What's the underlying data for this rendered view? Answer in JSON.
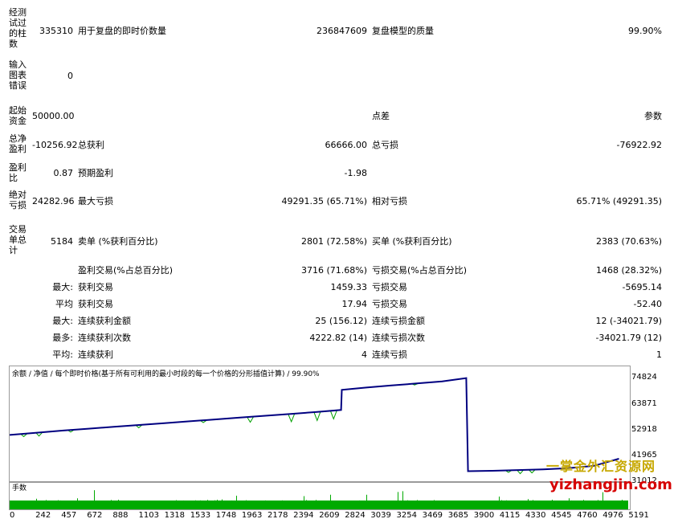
{
  "stats": {
    "bars": {
      "label": "经测试过的柱数",
      "value": "335310"
    },
    "ticks": {
      "label": "用于复盘的即时价数量",
      "value": "236847609"
    },
    "quality": {
      "label": "复盘模型的质量",
      "value": "99.90%"
    },
    "errors": {
      "label": "输入图表错误",
      "value": "0"
    },
    "deposit": {
      "label": "起始资金",
      "value": "50000.00"
    },
    "spread": {
      "label": "点差",
      "value": "参数"
    },
    "net_profit": {
      "label": "总净盈利",
      "value": "-10256.92"
    },
    "gross_profit": {
      "label": "总获利",
      "value": "66666.00"
    },
    "gross_loss": {
      "label": "总亏损",
      "value": "-76922.92"
    },
    "profit_factor": {
      "label": "盈利比",
      "value": "0.87"
    },
    "expected_payoff": {
      "label": "预期盈利",
      "value": "-1.98"
    },
    "abs_drawdown": {
      "label": "绝对亏损",
      "value": "24282.96"
    },
    "max_drawdown": {
      "label": "最大亏损",
      "value": "49291.35 (65.71%)"
    },
    "rel_drawdown": {
      "label": "相对亏损",
      "value": "65.71% (49291.35)"
    },
    "total_trades": {
      "label": "交易单总计",
      "value": "5184"
    },
    "short_positions": {
      "label": "卖单 (%获利百分比)",
      "value": "2801 (72.58%)"
    },
    "long_positions": {
      "label": "买单 (%获利百分比)",
      "value": "2383 (70.63%)"
    },
    "profit_trades": {
      "label": "盈利交易(%占总百分比)",
      "value": "3716 (71.68%)"
    },
    "loss_trades": {
      "label": "亏损交易(%占总百分比)",
      "value": "1468 (28.32%)"
    }
  },
  "rows": [
    {
      "prefix": "最大:",
      "l_label": "获利交易",
      "l_value": "1459.33",
      "r_label": "亏损交易",
      "r_value": "-5695.14"
    },
    {
      "prefix": "平均",
      "l_label": "获利交易",
      "l_value": "17.94",
      "r_label": "亏损交易",
      "r_value": "-52.40"
    },
    {
      "prefix": "最大:",
      "l_label": "连续获利金额",
      "l_value": "25 (156.12)",
      "r_label": "连续亏损金额",
      "r_value": "12 (-34021.79)"
    },
    {
      "prefix": "最多:",
      "l_label": "连续获利次数",
      "l_value": "4222.82 (14)",
      "r_label": "连续亏损次数",
      "r_value": "-34021.79 (12)"
    },
    {
      "prefix": "平均:",
      "l_label": "连续获利",
      "l_value": "4",
      "r_label": "连续亏损",
      "r_value": "1"
    }
  ],
  "chart": {
    "legend": "余额 / 净值 / 每个即时价格(基于所有可利用的最小时段的每一个价格的分形插值计算) / 99.90%",
    "volume_label": "手数",
    "y_ticks": [
      "74824",
      "63871",
      "52918",
      "41965",
      "31012"
    ],
    "x_ticks": [
      "0",
      "242",
      "457",
      "672",
      "888",
      "1103",
      "1318",
      "1533",
      "1748",
      "1963",
      "2178",
      "2394",
      "2609",
      "2824",
      "3039",
      "3254",
      "3469",
      "3685",
      "3900",
      "4115",
      "4330",
      "4545",
      "4760",
      "4976",
      "5191"
    ],
    "balance_color": "#000080",
    "equity_color": "#00a000",
    "volume_color": "#00aa00"
  },
  "chart_data": {
    "type": "line",
    "x": [
      0,
      242,
      457,
      672,
      888,
      1103,
      1318,
      1533,
      1748,
      1963,
      2178,
      2394,
      2609,
      2824,
      2830,
      3039,
      3254,
      3469,
      3685,
      3890,
      3905,
      4115,
      4330,
      4545,
      4760,
      4976,
      5191
    ],
    "series": [
      {
        "name": "余额",
        "values": [
          50000,
          51000,
          51900,
          52700,
          53500,
          54300,
          55100,
          55900,
          56700,
          57500,
          58300,
          59100,
          59900,
          60800,
          69500,
          70500,
          71400,
          72300,
          73200,
          74600,
          34300,
          34500,
          34800,
          35100,
          35600,
          36600,
          39700
        ]
      }
    ],
    "ylim": [
      31012,
      74824
    ],
    "xlim": [
      0,
      5191
    ],
    "y_ticks": [
      74824,
      63871,
      52918,
      41965,
      31012
    ]
  },
  "watermark": {
    "line1": "一掌金外汇资源网",
    "line2": "yizhangjin.com"
  }
}
